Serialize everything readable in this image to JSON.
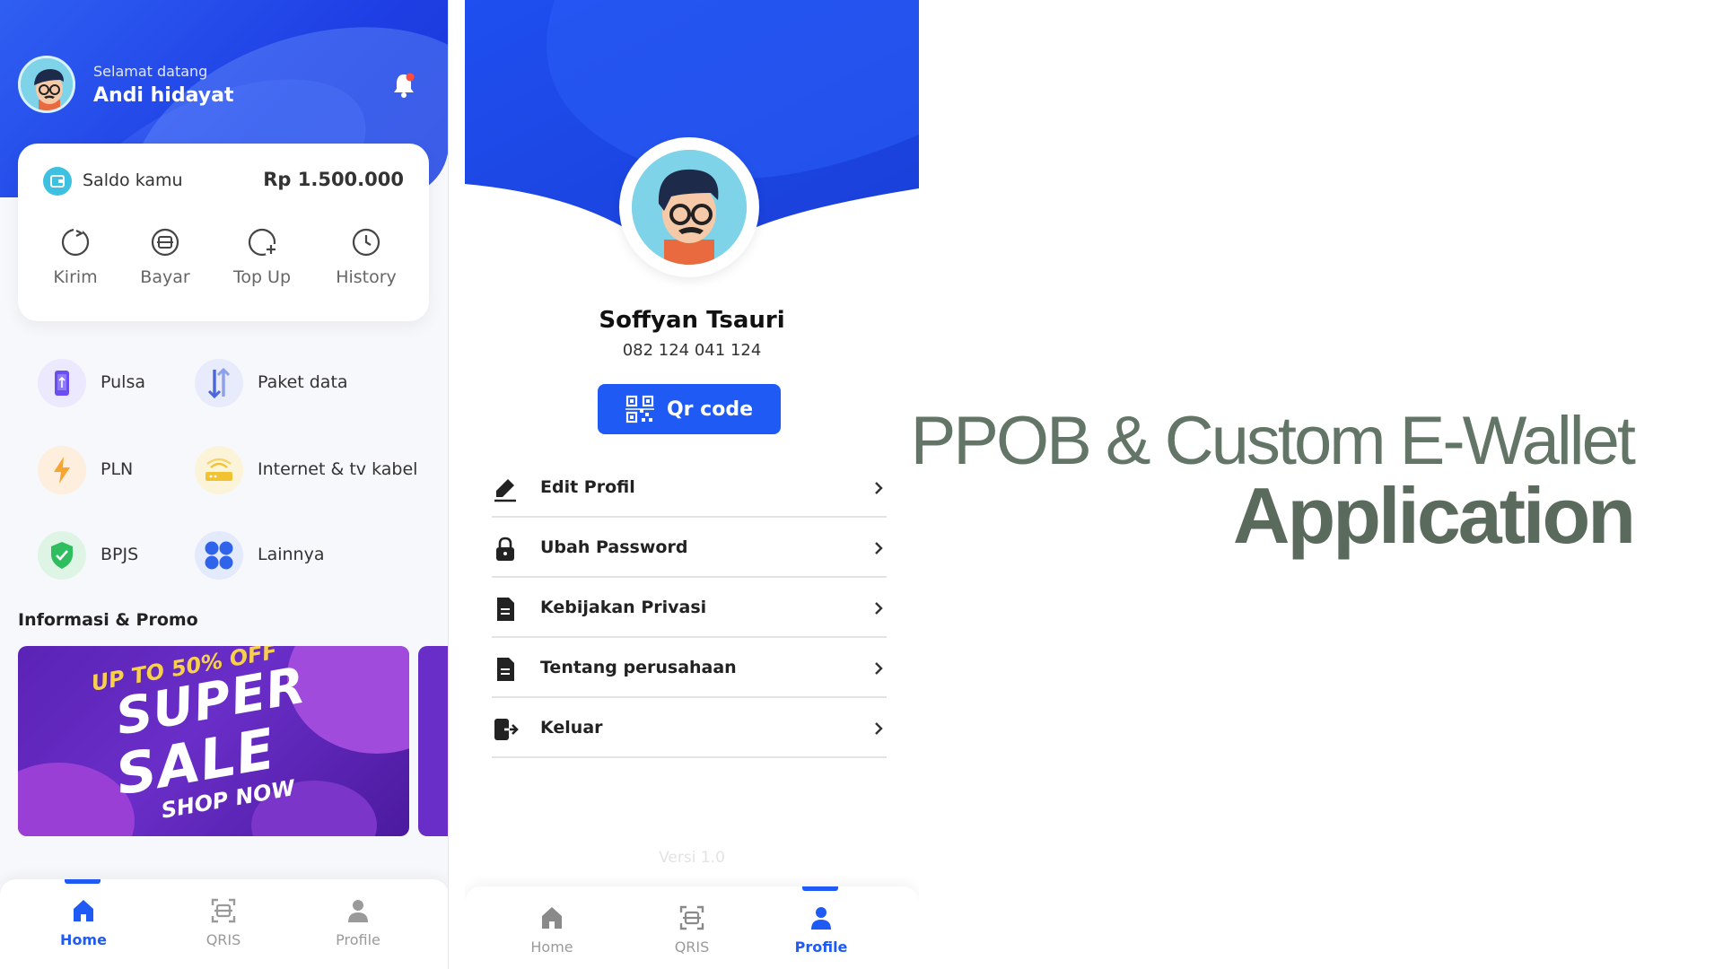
{
  "home": {
    "greeting": "Selamat datang",
    "user_name": "Andi hidayat",
    "balance": {
      "label": "Saldo kamu",
      "value": "Rp 1.500.000"
    },
    "quick_actions": [
      {
        "label": "Kirim",
        "icon": "send-icon"
      },
      {
        "label": "Bayar",
        "icon": "pay-icon"
      },
      {
        "label": "Top Up",
        "icon": "topup-icon"
      },
      {
        "label": "History",
        "icon": "clock-icon"
      }
    ],
    "services": [
      {
        "label": "Pulsa",
        "icon": "phone-icon",
        "color": "#6b4df0"
      },
      {
        "label": "Paket data",
        "icon": "data-transfer-icon",
        "color": "#4a66d8"
      },
      {
        "label": "PLN",
        "icon": "lightning-icon",
        "color": "#f7a531"
      },
      {
        "label": "Internet & tv kabel",
        "icon": "router-icon",
        "color": "#f1c232"
      },
      {
        "label": "BPJS",
        "icon": "shield-check-icon",
        "color": "#2fbe5f"
      },
      {
        "label": "Lainnya",
        "icon": "grid-icon",
        "color": "#2f63ea"
      }
    ],
    "promo_title": "Informasi & Promo",
    "promo": {
      "line1": "UP TO 50% OFF",
      "line2": "SUPER",
      "line3": "SALE",
      "line4": "SHOP NOW"
    },
    "nav": [
      {
        "label": "Home",
        "active": true
      },
      {
        "label": "QRIS",
        "active": false
      },
      {
        "label": "Profile",
        "active": false
      }
    ]
  },
  "profile": {
    "name": "Soffyan Tsauri",
    "phone": "082 124 041 124",
    "qr_label": "Qr code",
    "menu": [
      {
        "label": "Edit Profil",
        "icon": "edit-icon"
      },
      {
        "label": "Ubah Password",
        "icon": "lock-icon"
      },
      {
        "label": "Kebijakan Privasi",
        "icon": "document-icon"
      },
      {
        "label": "Tentang perusahaan",
        "icon": "document-icon"
      },
      {
        "label": "Keluar",
        "icon": "logout-icon"
      }
    ],
    "version": "Versi 1.0",
    "nav": [
      {
        "label": "Home",
        "active": false
      },
      {
        "label": "QRIS",
        "active": false
      },
      {
        "label": "Profile",
        "active": true
      }
    ]
  },
  "headline": {
    "line1": "PPOB & Custom E-Wallet",
    "line2": "Application"
  },
  "colors": {
    "primary_blue": "#1f5af5",
    "headline_green": "#5a6b5d"
  }
}
